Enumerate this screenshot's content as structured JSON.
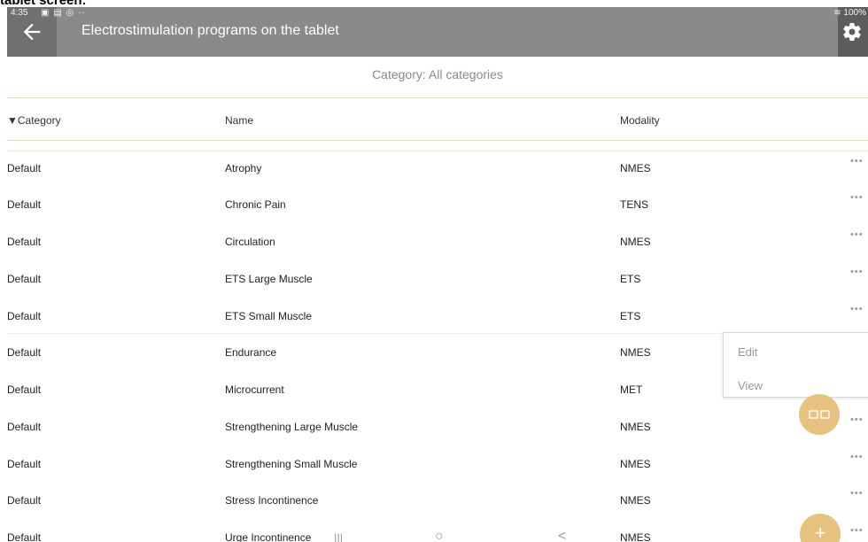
{
  "caption": "tablet screen:",
  "status_bar": {
    "time": "4:35",
    "indicators": "▣ ▤ ◎ ··",
    "battery": "≋ 100%"
  },
  "header": {
    "title": "Electrostimulation programs on the tablet",
    "back_icon": "arrow-left-icon",
    "settings_icon": "gear-icon"
  },
  "category_filter": "Category: All categories",
  "columns": {
    "category": "▼Category",
    "name": "Name",
    "modality": "Modality"
  },
  "rows": [
    {
      "category": "Default",
      "name": "Atrophy",
      "modality": "NMES",
      "more": "•••"
    },
    {
      "category": "Default",
      "name": "Chronic Pain",
      "modality": "TENS",
      "more": "•••"
    },
    {
      "category": "Default",
      "name": "Circulation",
      "modality": "NMES",
      "more": "•••"
    },
    {
      "category": "Default",
      "name": "ETS Large Muscle",
      "modality": "ETS",
      "more": "•••"
    },
    {
      "category": "Default",
      "name": "ETS Small Muscle",
      "modality": "ETS",
      "more": "•••"
    },
    {
      "category": "Default",
      "name": "Endurance",
      "modality": "NMES",
      "more": ""
    },
    {
      "category": "Default",
      "name": "Microcurrent",
      "modality": "MET",
      "more": ""
    },
    {
      "category": "Default",
      "name": "Strengthening Large Muscle",
      "modality": "NMES",
      "more": "•••"
    },
    {
      "category": "Default",
      "name": "Strengthening Small Muscle",
      "modality": "NMES",
      "more": "•••"
    },
    {
      "category": "Default",
      "name": "Stress Incontinence",
      "modality": "NMES",
      "more": "•••"
    },
    {
      "category": "Default",
      "name": "Urge Incontinence",
      "modality": "NMES",
      "more": "•••"
    }
  ],
  "context_menu": {
    "edit": "Edit",
    "view": "View"
  },
  "fab": {
    "add": "+",
    "grid_icon": "grid-view-icon"
  },
  "system_nav": {
    "recents": "|||",
    "home": "○",
    "back": "<"
  },
  "colors": {
    "app_bar": "#8a8a8a",
    "accent_fab": "#e7c17e",
    "divider": "#eadcc0"
  }
}
